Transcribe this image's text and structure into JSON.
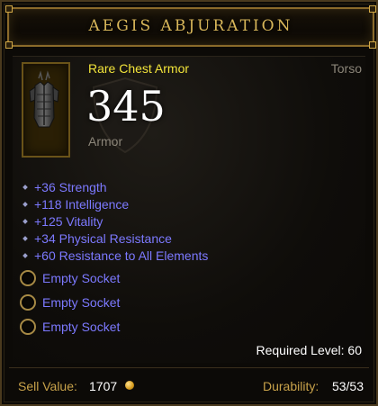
{
  "item": {
    "name": "AEGIS ABJURATION",
    "type": "Rare Chest Armor",
    "slot": "Torso",
    "armor_value": "345",
    "armor_label": "Armor",
    "icon": "chest-armor-icon"
  },
  "stats": [
    "+36 Strength",
    "+118 Intelligence",
    "+125 Vitality",
    "+34 Physical Resistance",
    "+60 Resistance to All Elements"
  ],
  "sockets": [
    "Empty Socket",
    "Empty Socket",
    "Empty Socket"
  ],
  "requirements": {
    "level_text": "Required Level: 60"
  },
  "footer": {
    "sell_label": "Sell Value:",
    "sell_value": "1707",
    "currency_icon": "gold-coin-icon",
    "durability_label": "Durability:",
    "durability_value": "53/53"
  },
  "colors": {
    "title": "#d9b75a",
    "rare": "#f2e43a",
    "magic_affix": "#7c79ff",
    "muted": "#8b8579",
    "gold_label": "#c8a24a"
  }
}
